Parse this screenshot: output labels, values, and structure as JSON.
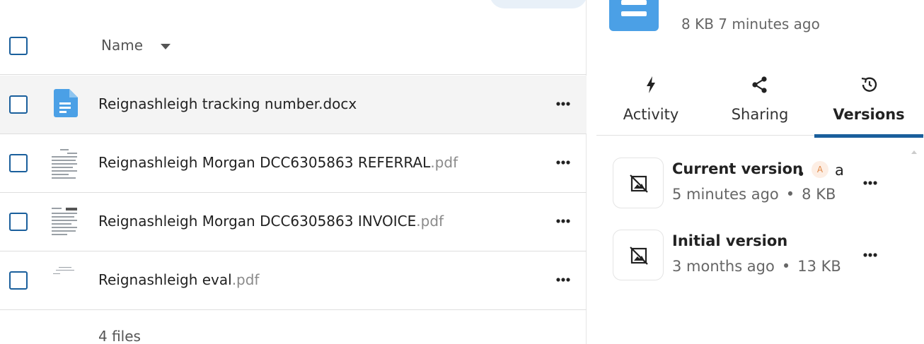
{
  "files": {
    "header": {
      "name_label": "Name"
    },
    "rows": [
      {
        "name": "Reignashleigh tracking number.docx",
        "ext": "",
        "type": "docx"
      },
      {
        "name": "Reignashleigh Morgan DCC6305863 REFERRAL",
        "ext": ".pdf",
        "type": "pdf"
      },
      {
        "name": "Reignashleigh Morgan DCC6305863 INVOICE",
        "ext": ".pdf",
        "type": "pdf"
      },
      {
        "name": "Reignashleigh eval",
        "ext": ".pdf",
        "type": "pdf"
      }
    ],
    "footer": {
      "count": "4 files"
    }
  },
  "sidebar": {
    "meta": "8 KB 7 minutes ago",
    "tabs": [
      {
        "label": "Activity",
        "icon": "lightning-icon"
      },
      {
        "label": "Sharing",
        "icon": "share-icon"
      },
      {
        "label": "Versions",
        "icon": "history-icon",
        "active": true
      }
    ],
    "versions": [
      {
        "title": "Current version",
        "author_initial": "A",
        "author": "a",
        "age": "5 minutes ago",
        "size": "8 KB"
      },
      {
        "title": "Initial version",
        "age": "3 months ago",
        "size": "13 KB"
      }
    ]
  },
  "colors": {
    "accent": "#1a5f9c",
    "doc_icon": "#4ba0e6"
  }
}
